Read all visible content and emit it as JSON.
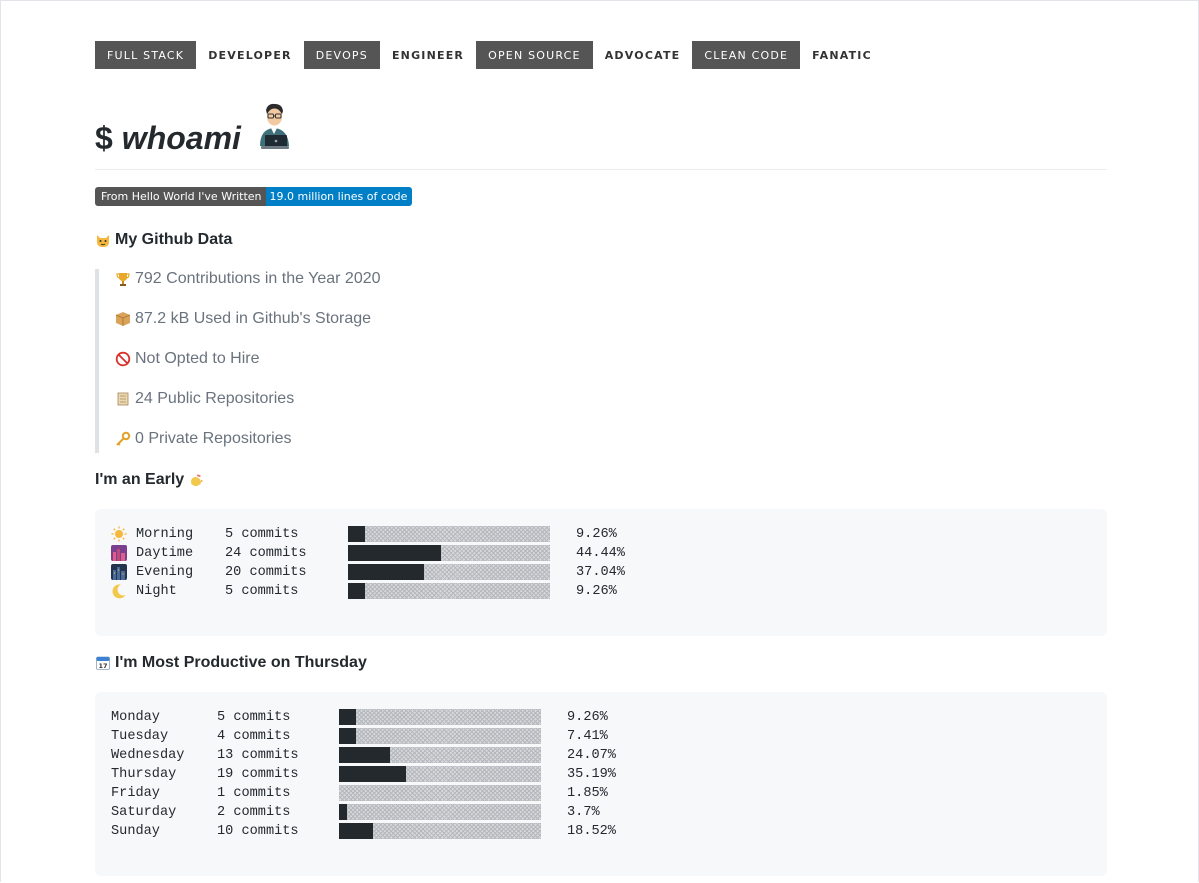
{
  "badges": [
    {
      "left": "FULL STACK",
      "right": "DEVELOPER"
    },
    {
      "left": "DEVOPS",
      "right": "ENGINEER"
    },
    {
      "left": "OPEN SOURCE",
      "right": "ADVOCATE"
    },
    {
      "left": "CLEAN CODE",
      "right": "FANATIC"
    }
  ],
  "heading": {
    "prompt": "$",
    "word": "whoami",
    "avatar_icon": "technologist-icon"
  },
  "loc_badge": {
    "label": "From Hello World I've Written",
    "value": "19.0 million lines of code"
  },
  "github": {
    "title": "My Github Data",
    "title_icon": "cat-face-icon",
    "items": [
      {
        "icon": "trophy-icon",
        "text": "792 Contributions in the Year 2020"
      },
      {
        "icon": "package-icon",
        "text": "87.2 kB Used in Github's Storage"
      },
      {
        "icon": "prohibited-icon",
        "text": "Not Opted to Hire"
      },
      {
        "icon": "scroll-icon",
        "text": "24 Public Repositories"
      },
      {
        "icon": "key-icon",
        "text": "0 Private Repositories"
      }
    ]
  },
  "early": {
    "title": "I'm an Early",
    "title_icon": "rooster-icon",
    "rows": [
      {
        "icon": "sun-icon",
        "label": "Morning",
        "commits": "5 commits",
        "percent": "9.26%",
        "fraction": 0.0926
      },
      {
        "icon": "city-dusk-icon",
        "label": "Daytime",
        "commits": "24 commits",
        "percent": "44.44%",
        "fraction": 0.4444
      },
      {
        "icon": "night-city-icon",
        "label": "Evening",
        "commits": "20 commits",
        "percent": "37.04%",
        "fraction": 0.3704
      },
      {
        "icon": "crescent-moon-icon",
        "label": "Night",
        "commits": "5 commits",
        "percent": "9.26%",
        "fraction": 0.0926
      }
    ]
  },
  "productive": {
    "title": "I'm Most Productive on Thursday",
    "title_icon": "calendar-icon",
    "rows": [
      {
        "label": "Monday",
        "commits": "5 commits",
        "percent": "9.26%",
        "fraction": 0.0926
      },
      {
        "label": "Tuesday",
        "commits": "4 commits",
        "percent": "7.41%",
        "fraction": 0.0741
      },
      {
        "label": "Wednesday",
        "commits": "13 commits",
        "percent": "24.07%",
        "fraction": 0.2407
      },
      {
        "label": "Thursday",
        "commits": "19 commits",
        "percent": "35.19%",
        "fraction": 0.3519
      },
      {
        "label": "Friday",
        "commits": "1 commits",
        "percent": "1.85%",
        "fraction": 0.0185
      },
      {
        "label": "Saturday",
        "commits": "2 commits",
        "percent": "3.7%",
        "fraction": 0.037
      },
      {
        "label": "Sunday",
        "commits": "10 commits",
        "percent": "18.52%",
        "fraction": 0.1852
      }
    ]
  },
  "colors": {
    "badge_dark": "#555555",
    "badge_blue": "#007ec6",
    "code_bg": "#f6f8fa",
    "bar_fill": "#24292e"
  }
}
